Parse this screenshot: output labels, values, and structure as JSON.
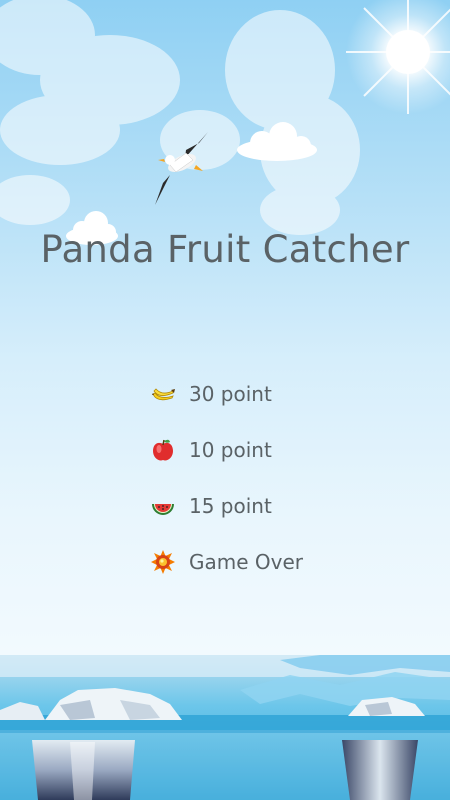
{
  "game": {
    "title": "Panda Fruit Catcher"
  },
  "legend": [
    {
      "icon": "banana-icon",
      "label": "30 point"
    },
    {
      "icon": "apple-icon",
      "label": "10 point"
    },
    {
      "icon": "watermelon-icon",
      "label": "15 point"
    },
    {
      "icon": "bomb-explosion-icon",
      "label": "Game Over"
    }
  ],
  "colors": {
    "sky_top": "#8fd0f3",
    "sky_bottom": "#f2fafe",
    "sea": "#46b8e3",
    "text": "#5a6266"
  }
}
